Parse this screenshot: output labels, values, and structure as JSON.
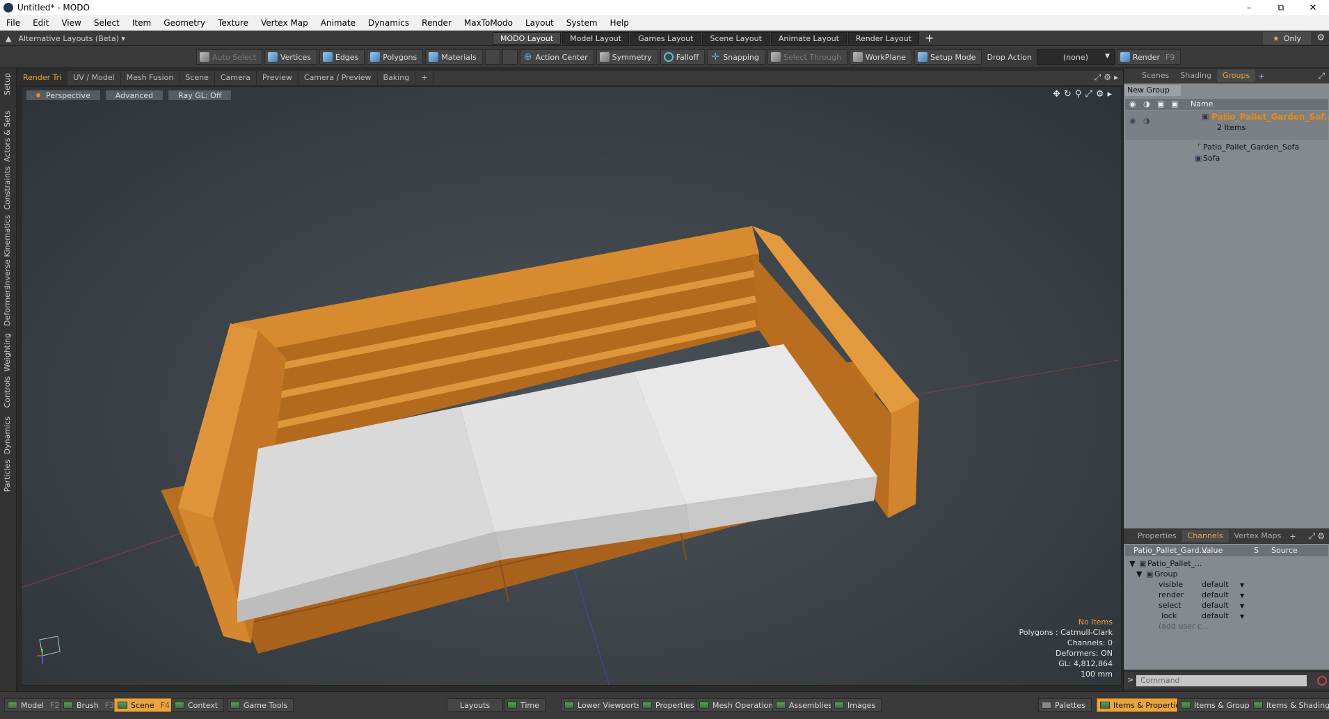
{
  "window": {
    "title": "Untitled* - MODO",
    "controls": [
      "–",
      "⧉",
      "✕"
    ]
  },
  "menu": [
    "File",
    "Edit",
    "View",
    "Select",
    "Item",
    "Geometry",
    "Texture",
    "Vertex Map",
    "Animate",
    "Dynamics",
    "Render",
    "MaxToModo",
    "Layout",
    "System",
    "Help"
  ],
  "layoutbar": {
    "alt_layouts": "Alternative Layouts (Beta) ▾",
    "tabs": [
      "MODO Layout",
      "Model Layout",
      "Games Layout",
      "Scene Layout",
      "Animate Layout",
      "Render Layout"
    ],
    "active_tab": 0,
    "only": "Only"
  },
  "toolbar": {
    "auto_select": "Auto Select",
    "vertices": "Vertices",
    "edges": "Edges",
    "polygons": "Polygons",
    "materials": "Materials",
    "action_center": "Action Center",
    "symmetry": "Symmetry",
    "falloff": "Falloff",
    "snapping": "Snapping",
    "select_through": "Select Through",
    "workplane": "WorkPlane",
    "setup_mode": "Setup Mode",
    "drop_action": "Drop Action",
    "drop_value": "(none)",
    "render": "Render",
    "render_key": "F9"
  },
  "left_tabs": [
    "Setup",
    "Actors & Sets",
    "Constraints",
    "Inverse Kinematics",
    "Deformers",
    "Weighting",
    "Controls",
    "Dynamics",
    "Particles"
  ],
  "viewport_tabs": [
    "Render Tri",
    "UV / Model",
    "Mesh Fusion",
    "Scene",
    "Camera",
    "Preview",
    "Camera / Preview",
    "Baking",
    "+"
  ],
  "viewport": {
    "view": "Perspective",
    "shading": "Advanced",
    "raygl": "Ray GL: Off",
    "info": {
      "items": "No Items",
      "polygons": "Polygons : Catmull-Clark",
      "channels": "Channels: 0",
      "deformers": "Deformers: ON",
      "gl": "GL: 4,812,864",
      "scale": "100 mm"
    }
  },
  "groups_panel": {
    "tabs": [
      "Scenes",
      "Shading",
      "Groups"
    ],
    "active_tab": 2,
    "new_group": "New Group",
    "column_name": "Name",
    "group_name": "Patio_Pallet_Garden_Sof...",
    "group_count": "2 Items",
    "children": [
      "Patio_Pallet_Garden_Sofa",
      "Sofa"
    ]
  },
  "channels_panel": {
    "tabs": [
      "Properties",
      "Channels",
      "Vertex Maps"
    ],
    "active_tab": 1,
    "headers": {
      "name": "Patio_Pallet_Gard...",
      "value": "Value",
      "s": "S",
      "source": "Source"
    },
    "item": "Patio_Pallet_...",
    "group": "Group",
    "rows": [
      {
        "name": "visible",
        "value": "default"
      },
      {
        "name": "render",
        "value": "default"
      },
      {
        "name": "select",
        "value": "default"
      },
      {
        "name": "lock",
        "value": "default"
      }
    ],
    "add_user": "(add user c..."
  },
  "command": {
    "placeholder": "Command",
    "prompt": ">"
  },
  "bottombar": {
    "model": "Model",
    "model_key": "F2",
    "brush": "Brush",
    "brush_key": "F3",
    "scene": "Scene",
    "scene_key": "F4",
    "context": "Context",
    "game_tools": "Game Tools",
    "layouts": "Layouts",
    "time": "Time",
    "lower_viewports": "Lower Viewports",
    "properties": "Properties",
    "mesh_operations": "Mesh Operations",
    "assemblies": "Assemblies",
    "images": "Images",
    "palettes": "Palettes",
    "items_properties": "Items & Properties",
    "items_groups": "Items & Groups",
    "items_shading": "Items & Shading"
  },
  "colors": {
    "accent": "#e8a440",
    "wood": "#d98a2e",
    "cushion": "#e6e6e6",
    "viewport_bg": "#3a4147"
  }
}
